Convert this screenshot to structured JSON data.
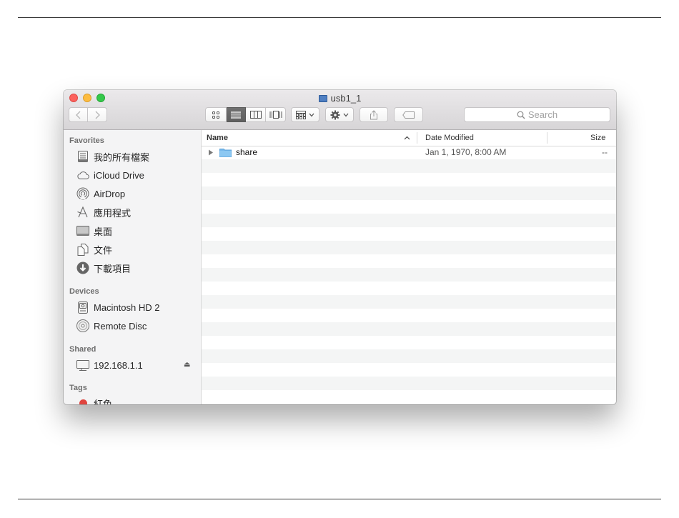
{
  "window": {
    "title": "usb1_1",
    "search_placeholder": "Search"
  },
  "sidebar": {
    "favorites_header": "Favorites",
    "favorites": [
      {
        "label": "我的所有檔案",
        "icon": "all-my-files-icon"
      },
      {
        "label": "iCloud Drive",
        "icon": "cloud-icon"
      },
      {
        "label": "AirDrop",
        "icon": "airdrop-icon"
      },
      {
        "label": "應用程式",
        "icon": "applications-icon"
      },
      {
        "label": "桌面",
        "icon": "desktop-icon"
      },
      {
        "label": "文件",
        "icon": "documents-icon"
      },
      {
        "label": "下載項目",
        "icon": "downloads-icon"
      }
    ],
    "devices_header": "Devices",
    "devices": [
      {
        "label": "Macintosh HD 2",
        "icon": "hard-drive-icon"
      },
      {
        "label": "Remote Disc",
        "icon": "disc-icon"
      }
    ],
    "shared_header": "Shared",
    "shared": [
      {
        "label": "192.168.1.1",
        "icon": "network-computer-icon"
      }
    ],
    "tags_header": "Tags",
    "tags": [
      {
        "label": "紅色",
        "color": "#e0443e"
      }
    ]
  },
  "columns": {
    "name": "Name",
    "date_modified": "Date Modified",
    "size": "Size"
  },
  "files": [
    {
      "name": "share",
      "date_modified": "Jan 1, 1970, 8:00 AM",
      "size": "--"
    }
  ]
}
